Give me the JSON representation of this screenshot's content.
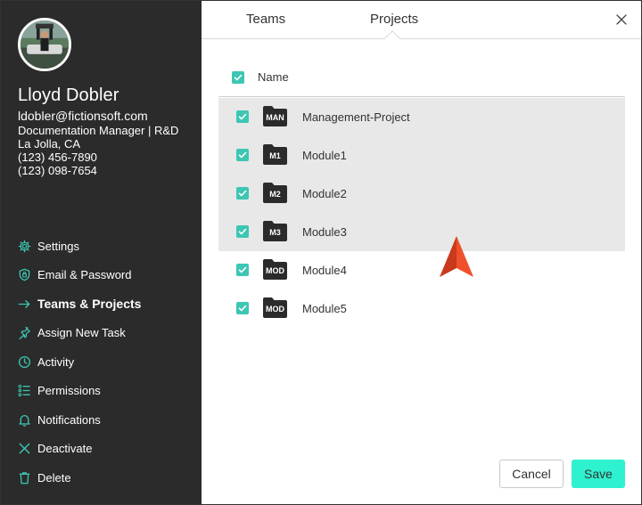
{
  "user": {
    "name": "Lloyd Dobler",
    "email": "ldobler@fictionsoft.com",
    "title": "Documentation Manager | R&D",
    "location": "La Jolla, CA",
    "phone1": "(123) 456-7890",
    "phone2": "(123) 098-7654"
  },
  "nav": {
    "settings": {
      "label": "Settings",
      "icon": "gear-icon"
    },
    "email_password": {
      "label": "Email & Password",
      "icon": "shield-icon"
    },
    "teams_projects": {
      "label": "Teams & Projects",
      "icon": "arrow-right-icon"
    },
    "assign_task": {
      "label": "Assign New Task",
      "icon": "pin-icon"
    },
    "activity": {
      "label": "Activity",
      "icon": "clock-icon"
    },
    "permissions": {
      "label": "Permissions",
      "icon": "list-icon"
    },
    "notifications": {
      "label": "Notifications",
      "icon": "bell-icon"
    },
    "deactivate": {
      "label": "Deactivate",
      "icon": "x-icon"
    },
    "delete": {
      "label": "Delete",
      "icon": "trash-icon"
    }
  },
  "tabs": {
    "teams": "Teams",
    "projects": "Projects"
  },
  "list": {
    "header": "Name",
    "projects": [
      {
        "abbr": "MAN",
        "name": "Management-Project",
        "checked": true,
        "selected": true
      },
      {
        "abbr": "M1",
        "name": "Module1",
        "checked": true,
        "selected": true
      },
      {
        "abbr": "M2",
        "name": "Module2",
        "checked": true,
        "selected": true
      },
      {
        "abbr": "M3",
        "name": "Module3",
        "checked": true,
        "selected": true
      },
      {
        "abbr": "MOD",
        "name": "Module4",
        "checked": true,
        "selected": false
      },
      {
        "abbr": "MOD",
        "name": "Module5",
        "checked": true,
        "selected": false
      }
    ]
  },
  "buttons": {
    "cancel": "Cancel",
    "save": "Save"
  },
  "colors": {
    "accent": "#3dc6b3",
    "save": "#2ef2cf",
    "sidebar": "#2b2b2b",
    "cursor": "#e8452a"
  }
}
